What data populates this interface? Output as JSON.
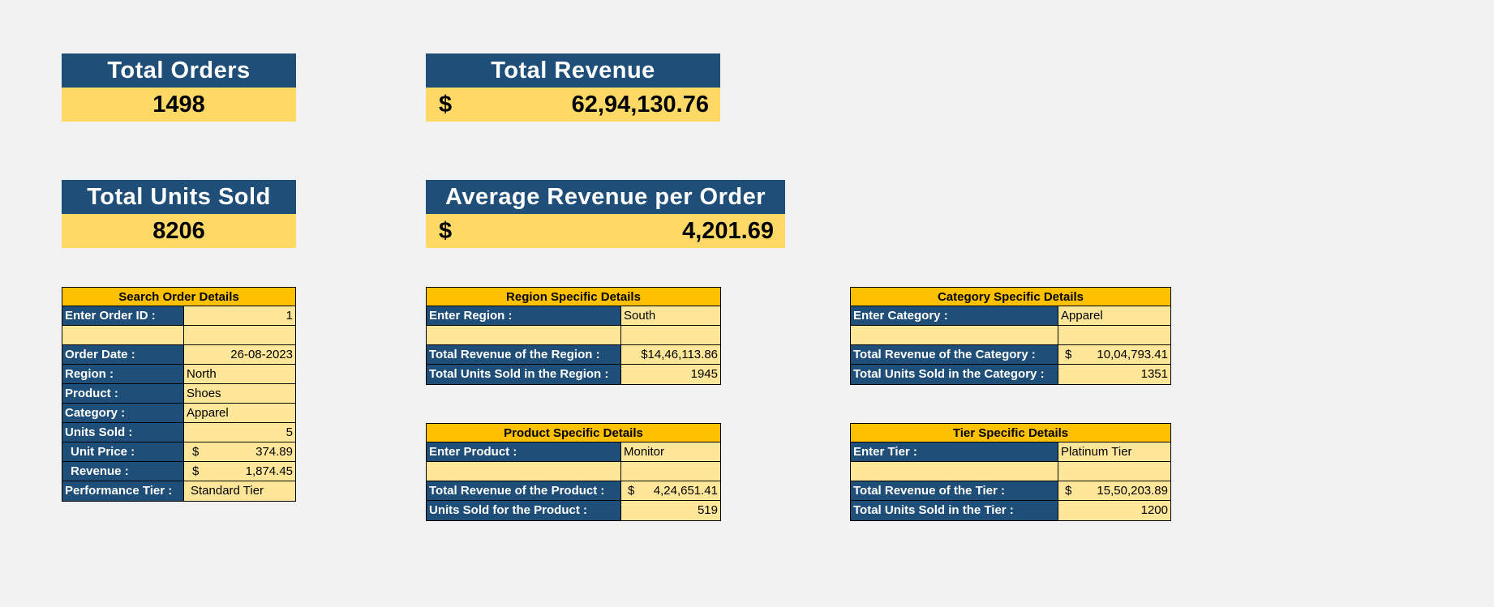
{
  "kpis": {
    "total_orders": {
      "title": "Total Orders",
      "value": "1498"
    },
    "total_revenue": {
      "title": "Total Revenue",
      "currency": "$",
      "value": "62,94,130.76"
    },
    "total_units": {
      "title": "Total Units Sold",
      "value": "8206"
    },
    "avg_revenue": {
      "title": "Average Revenue per Order",
      "currency": "$",
      "value": "4,201.69"
    }
  },
  "search": {
    "title": "Search Order Details",
    "order_id_label": "Enter Order ID :",
    "order_id_value": "1",
    "order_date_label": "Order Date :",
    "order_date_value": "26-08-2023",
    "region_label": "Region :",
    "region_value": "North",
    "product_label": "Product :",
    "product_value": "Shoes",
    "category_label": "Category :",
    "category_value": "Apparel",
    "units_label": "Units Sold :",
    "units_value": "5",
    "unit_price_label": "Unit Price :",
    "unit_price_currency": "$",
    "unit_price_value": "374.89",
    "revenue_label": "Revenue :",
    "revenue_currency": "$",
    "revenue_value": "1,874.45",
    "tier_label": "Performance Tier :",
    "tier_value": "Standard Tier"
  },
  "region": {
    "title": "Region Specific Details",
    "input_label": "Enter Region :",
    "input_value": "South",
    "revenue_label": "Total Revenue of the Region :",
    "revenue_value": "$14,46,113.86",
    "units_label": "Total Units Sold in the Region :",
    "units_value": "1945"
  },
  "product": {
    "title": "Product Specific Details",
    "input_label": "Enter Product :",
    "input_value": "Monitor",
    "revenue_label": "Total Revenue of the Product :",
    "revenue_currency": "$",
    "revenue_value": "4,24,651.41",
    "units_label": "Units Sold for the Product :",
    "units_value": "519"
  },
  "category": {
    "title": "Category Specific Details",
    "input_label": "Enter Category :",
    "input_value": "Apparel",
    "revenue_label": "Total Revenue of the Category :",
    "revenue_currency": "$",
    "revenue_value": "10,04,793.41",
    "units_label": "Total Units Sold in the Category :",
    "units_value": "1351"
  },
  "tier": {
    "title": "Tier Specific Details",
    "input_label": "Enter Tier :",
    "input_value": "Platinum Tier",
    "revenue_label": "Total Revenue of the Tier :",
    "revenue_currency": "$",
    "revenue_value": "15,50,203.89",
    "units_label": "Total Units Sold in the Tier :",
    "units_value": "1200"
  }
}
